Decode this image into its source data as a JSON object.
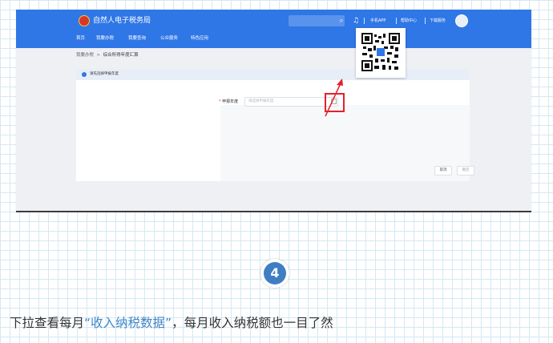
{
  "header": {
    "brand": "自然人电子税务局",
    "links": [
      "手机APP",
      "帮助中心",
      "下载服务"
    ],
    "nav": [
      "首页",
      "我要办税",
      "我要查询",
      "公众服务",
      "特色应用"
    ]
  },
  "breadcrumb": {
    "root": "我要办税",
    "separator": ">",
    "current": "综合所得年度汇算"
  },
  "panel": {
    "title": "请先选择申报年度",
    "field_label": "申报年度",
    "field_required": "*",
    "field_placeholder": "请选择申报年度",
    "cancel_label": "取消",
    "confirm_label": "确定"
  },
  "step": {
    "number": "4"
  },
  "caption": {
    "before": "下拉查看每月",
    "highlight": "“收入纳税数据”",
    "after": "，每月收入纳税额也一目了然"
  },
  "colors": {
    "header_blue": "#2f77e6",
    "highlight_red": "#e3222b",
    "caption_highlight": "#3f86c7",
    "badge_blue": "#3f7ec3"
  },
  "icons": {
    "logo": "tax-emblem-icon",
    "search": "search-icon",
    "bell": "bell-icon",
    "avatar": "avatar-icon",
    "calendar": "calendar-icon",
    "qr": "qr-code"
  }
}
